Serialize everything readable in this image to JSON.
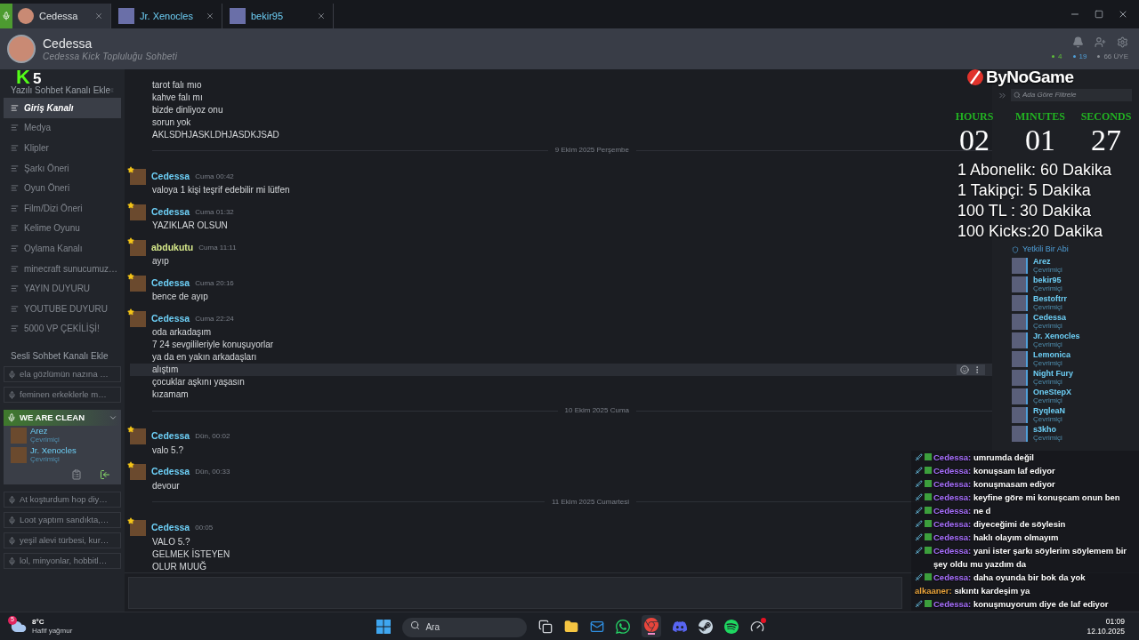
{
  "tabs": [
    {
      "label": "Cedessa",
      "selected": true,
      "voice": true
    },
    {
      "label": "Jr. Xenocles",
      "selected": false,
      "voice": false
    },
    {
      "label": "bekir95",
      "selected": false,
      "voice": false
    }
  ],
  "header": {
    "title": "Cedessa",
    "subtitle": "Cedessa Kick Topluluğu Sohbeti",
    "counts": [
      {
        "text": "4",
        "color": "#5fbf3a"
      },
      {
        "text": "19",
        "color": "#4f9fd8"
      },
      {
        "text": "66 ÜYE",
        "color": "#8b8f96"
      }
    ]
  },
  "sidebar": {
    "text_header": "Yazılı Sohbet Kanalı Ekle",
    "text_channels": [
      {
        "name": "Giriş Kanalı",
        "selected": true
      },
      {
        "name": "Medya",
        "selected": false
      },
      {
        "name": "Klipler",
        "selected": false
      },
      {
        "name": "Şarkı Öneri",
        "selected": false
      },
      {
        "name": "Oyun Öneri",
        "selected": false
      },
      {
        "name": "Film/Dizi Öneri",
        "selected": false
      },
      {
        "name": "Kelime Oyunu",
        "selected": false
      },
      {
        "name": "Oylama Kanalı",
        "selected": false
      },
      {
        "name": "minecraft sunucumuz…",
        "selected": false
      },
      {
        "name": "YAYIN DUYURU",
        "selected": false
      },
      {
        "name": "YOUTUBE DUYURU",
        "selected": false
      },
      {
        "name": "5000 VP ÇEKİLİŞİ!",
        "selected": false
      }
    ],
    "voice_header": "Sesli Sohbet Kanalı Ekle",
    "voice_channels": [
      {
        "name": "ela gözlümün nazına …",
        "expanded": false
      },
      {
        "name": "feminen erkeklerle m…",
        "expanded": false
      },
      {
        "name": "WE ARE CLEAN",
        "expanded": true,
        "members": [
          {
            "name": "Arez",
            "status": "Çevrimiçi"
          },
          {
            "name": "Jr. Xenocles",
            "status": "Çevrimiçi"
          }
        ]
      },
      {
        "name": "At koşturdum hop diy…",
        "expanded": false
      },
      {
        "name": "Loot yaptım sandıkta,…",
        "expanded": false
      },
      {
        "name": "yeşil alevi türbesi, kur…",
        "expanded": false
      },
      {
        "name": "lol, minyonlar, hobbitl…",
        "expanded": false
      }
    ]
  },
  "chat": [
    {
      "kind": "lines",
      "lines": [
        {
          "text": "tarot falı mıo",
          "highlighted": false
        },
        {
          "text": "kahve falı mı",
          "highlighted": false
        },
        {
          "text": "bizde dinliyoz onu",
          "highlighted": false
        },
        {
          "text": "sorun yok",
          "highlighted": false
        },
        {
          "text": "AKLSDHJASKLDHJASDKJSAD",
          "highlighted": false
        }
      ]
    },
    {
      "kind": "divider",
      "text": "9 Ekim 2025 Perşembe"
    },
    {
      "kind": "message",
      "author": "Cedessa",
      "color": "#6dcff6",
      "time": "Cuma 00:42",
      "lines": [
        {
          "text": "valoya 1 kişi teşrif edebilir mi lütfen",
          "highlighted": false
        }
      ]
    },
    {
      "kind": "message",
      "author": "Cedessa",
      "color": "#6dcff6",
      "time": "Cuma 01:32",
      "lines": [
        {
          "text": "YAZIKLAR OLSUN",
          "highlighted": false
        }
      ]
    },
    {
      "kind": "message",
      "author": "abdukutu",
      "color": "#d6e88a",
      "time": "Cuma 11:11",
      "lines": [
        {
          "text": "ayıp",
          "highlighted": false
        }
      ]
    },
    {
      "kind": "message",
      "author": "Cedessa",
      "color": "#6dcff6",
      "time": "Cuma 20:16",
      "lines": [
        {
          "text": "bence de ayıp",
          "highlighted": false
        }
      ]
    },
    {
      "kind": "message",
      "author": "Cedessa",
      "color": "#6dcff6",
      "time": "Cuma 22:24",
      "lines": [
        {
          "text": "oda arkadaşım",
          "highlighted": false
        },
        {
          "text": "7 24 sevgilileriyle konuşuyorlar",
          "highlighted": false
        },
        {
          "text": "ya da en yakın arkadaşları",
          "highlighted": false
        },
        {
          "text": "alıştım",
          "highlighted": true
        },
        {
          "text": "çocuklar aşkını yaşasın",
          "highlighted": false
        },
        {
          "text": "kızamam",
          "highlighted": false
        }
      ]
    },
    {
      "kind": "divider",
      "text": "10 Ekim 2025 Cuma"
    },
    {
      "kind": "message",
      "author": "Cedessa",
      "color": "#6dcff6",
      "time": "Dün, 00:02",
      "lines": [
        {
          "text": "valo 5.?",
          "highlighted": false
        }
      ]
    },
    {
      "kind": "message",
      "author": "Cedessa",
      "color": "#6dcff6",
      "time": "Dün, 00:33",
      "lines": [
        {
          "text": "devour",
          "highlighted": false
        }
      ]
    },
    {
      "kind": "divider",
      "text": "11 Ekim 2025 Cumartesi"
    },
    {
      "kind": "message",
      "author": "Cedessa",
      "color": "#6dcff6",
      "time": "00:05",
      "lines": [
        {
          "text": "VALO 5.?",
          "highlighted": false
        },
        {
          "text": "GELMEK İSTEYEN",
          "highlighted": false
        },
        {
          "text": "OLUR MUUĞ",
          "highlighted": false
        }
      ]
    }
  ],
  "members": {
    "filter_placeholder": "Ada Göre Filtrele",
    "role": "Yetkili Bir Abi",
    "list": [
      {
        "name": "Arez",
        "status": "Çevrimiçi"
      },
      {
        "name": "bekir95",
        "status": "Çevrimiçi"
      },
      {
        "name": "Bestoftrr",
        "status": "Çevrimiçi"
      },
      {
        "name": "Cedessa",
        "status": "Çevrimiçi"
      },
      {
        "name": "Jr. Xenocles",
        "status": "Çevrimiçi"
      },
      {
        "name": "Lemonica",
        "status": "Çevrimiçi"
      },
      {
        "name": "Night Fury",
        "status": "Çevrimiçi"
      },
      {
        "name": "OneStepX",
        "status": "Çevrimiçi"
      },
      {
        "name": "RyqleaN",
        "status": "Çevrimiçi"
      },
      {
        "name": "s3kho",
        "status": "Çevrimiçi"
      }
    ]
  },
  "overlay": {
    "kick_badge": {
      "letter": "K",
      "count": "5"
    },
    "sponsor": "ByNoGame",
    "timer": [
      {
        "label": "HOURS",
        "value": "02"
      },
      {
        "label": "MINUTES",
        "value": "01"
      },
      {
        "label": "SECONDS",
        "value": "27"
      }
    ],
    "rates": [
      "1 Abonelik: 60 Dakika",
      "1 Takipçi: 5 Dakika",
      "100 TL : 30 Dakika",
      "100 Kicks:20 Dakika"
    ],
    "stream_chat": [
      {
        "user": "Cedessa:",
        "color": "#a970ff",
        "badges": true,
        "text": "umrumda değil"
      },
      {
        "user": "Cedessa:",
        "color": "#a970ff",
        "badges": true,
        "text": "konuşsam laf ediyor"
      },
      {
        "user": "Cedessa:",
        "color": "#a970ff",
        "badges": true,
        "text": "konuşmasam ediyor"
      },
      {
        "user": "Cedessa:",
        "color": "#a970ff",
        "badges": true,
        "text": "keyfine göre mi konuşcam onun ben"
      },
      {
        "user": "Cedessa:",
        "color": "#a970ff",
        "badges": true,
        "text": "ne d"
      },
      {
        "user": "Cedessa:",
        "color": "#a970ff",
        "badges": true,
        "text": "diyeceğimi de söylesin"
      },
      {
        "user": "Cedessa:",
        "color": "#a970ff",
        "badges": true,
        "text": "haklı olayım olmayım"
      },
      {
        "user": "Cedessa:",
        "color": "#a970ff",
        "badges": true,
        "text": "yani ister şarkı söylerim söylemem bir şey oldu mu yazdım da"
      },
      {
        "user": "Cedessa:",
        "color": "#a970ff",
        "badges": true,
        "text": "daha oyunda bir bok da yok"
      },
      {
        "user": "alkaaner:",
        "color": "#e8a23a",
        "badges": false,
        "text": "sıkıntı kardeşim ya"
      },
      {
        "user": "Cedessa:",
        "color": "#a970ff",
        "badges": true,
        "text": "konuşmuyorum diye de laf ediyor"
      }
    ]
  },
  "taskbar": {
    "weather": {
      "badge": "5",
      "temp": "8°C",
      "desc": "Hafif yağmur"
    },
    "search_placeholder": "Ara",
    "apps": [
      {
        "kind": "taskview"
      },
      {
        "kind": "folder"
      },
      {
        "kind": "mail"
      },
      {
        "kind": "whatsapp"
      },
      {
        "kind": "chrome"
      },
      {
        "kind": "discord"
      },
      {
        "kind": "steam"
      },
      {
        "kind": "spotify"
      },
      {
        "kind": "gauge"
      }
    ],
    "clock": {
      "time": "01:09",
      "date": "12.10.2025"
    }
  }
}
